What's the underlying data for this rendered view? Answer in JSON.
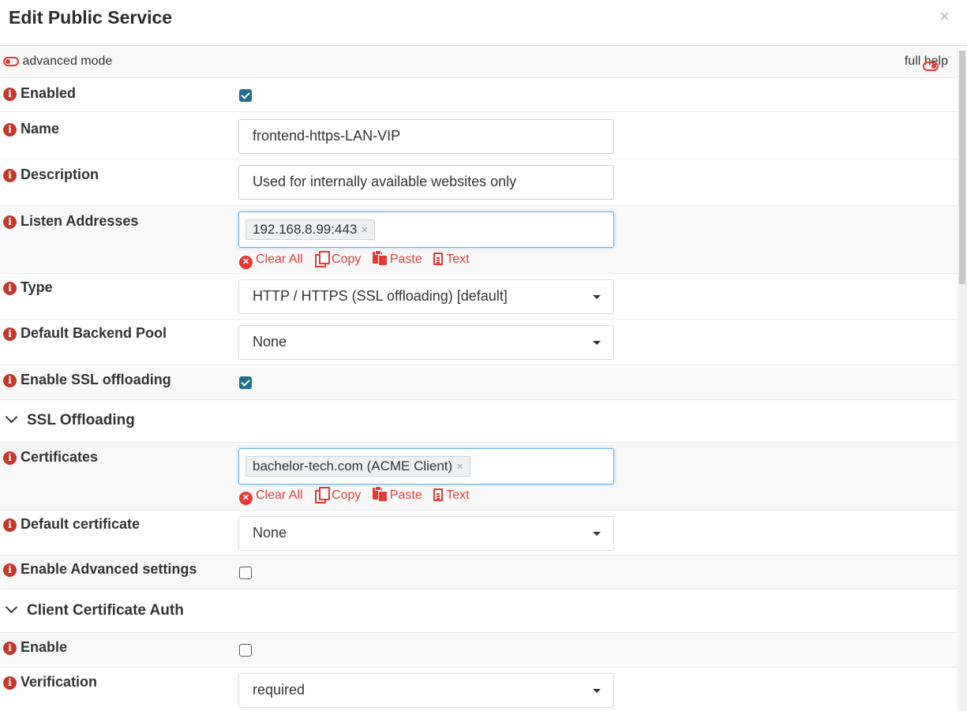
{
  "dialog": {
    "title": "Edit Public Service",
    "close": "×"
  },
  "modebar": {
    "advanced_label": "advanced mode",
    "help_label": "full help"
  },
  "fields": {
    "enabled": {
      "label": "Enabled",
      "checked": true
    },
    "name": {
      "label": "Name",
      "value": "frontend-https-LAN-VIP"
    },
    "description": {
      "label": "Description",
      "value": "Used for internally available websites only"
    },
    "listen": {
      "label": "Listen Addresses",
      "tags": [
        "192.168.8.99:443"
      ]
    },
    "type": {
      "label": "Type",
      "value": "HTTP / HTTPS (SSL offloading) [default]"
    },
    "backend": {
      "label": "Default Backend Pool",
      "value": "None"
    },
    "ssl": {
      "label": "Enable SSL offloading",
      "checked": true
    },
    "certs": {
      "label": "Certificates",
      "tags": [
        "bachelor-tech.com (ACME Client)"
      ]
    },
    "defcert": {
      "label": "Default certificate",
      "value": "None"
    },
    "advsettings": {
      "label": "Enable Advanced settings",
      "checked": false
    },
    "cca_enable": {
      "label": "Enable",
      "checked": false
    },
    "verification": {
      "label": "Verification",
      "value": "required"
    }
  },
  "sections": {
    "ssl": "SSL Offloading",
    "cca": "Client Certificate Auth"
  },
  "tools": {
    "clear": "Clear All",
    "copy": "Copy",
    "paste": "Paste",
    "text": "Text",
    "remove": "×"
  },
  "colors": {
    "accent": "#e53935",
    "info": "#c0392b",
    "checkbox": "#1e6f8e"
  },
  "icons": {
    "info": "info-circle-icon",
    "toggle": "toggle-icon",
    "chevron": "chevron-down-icon"
  }
}
